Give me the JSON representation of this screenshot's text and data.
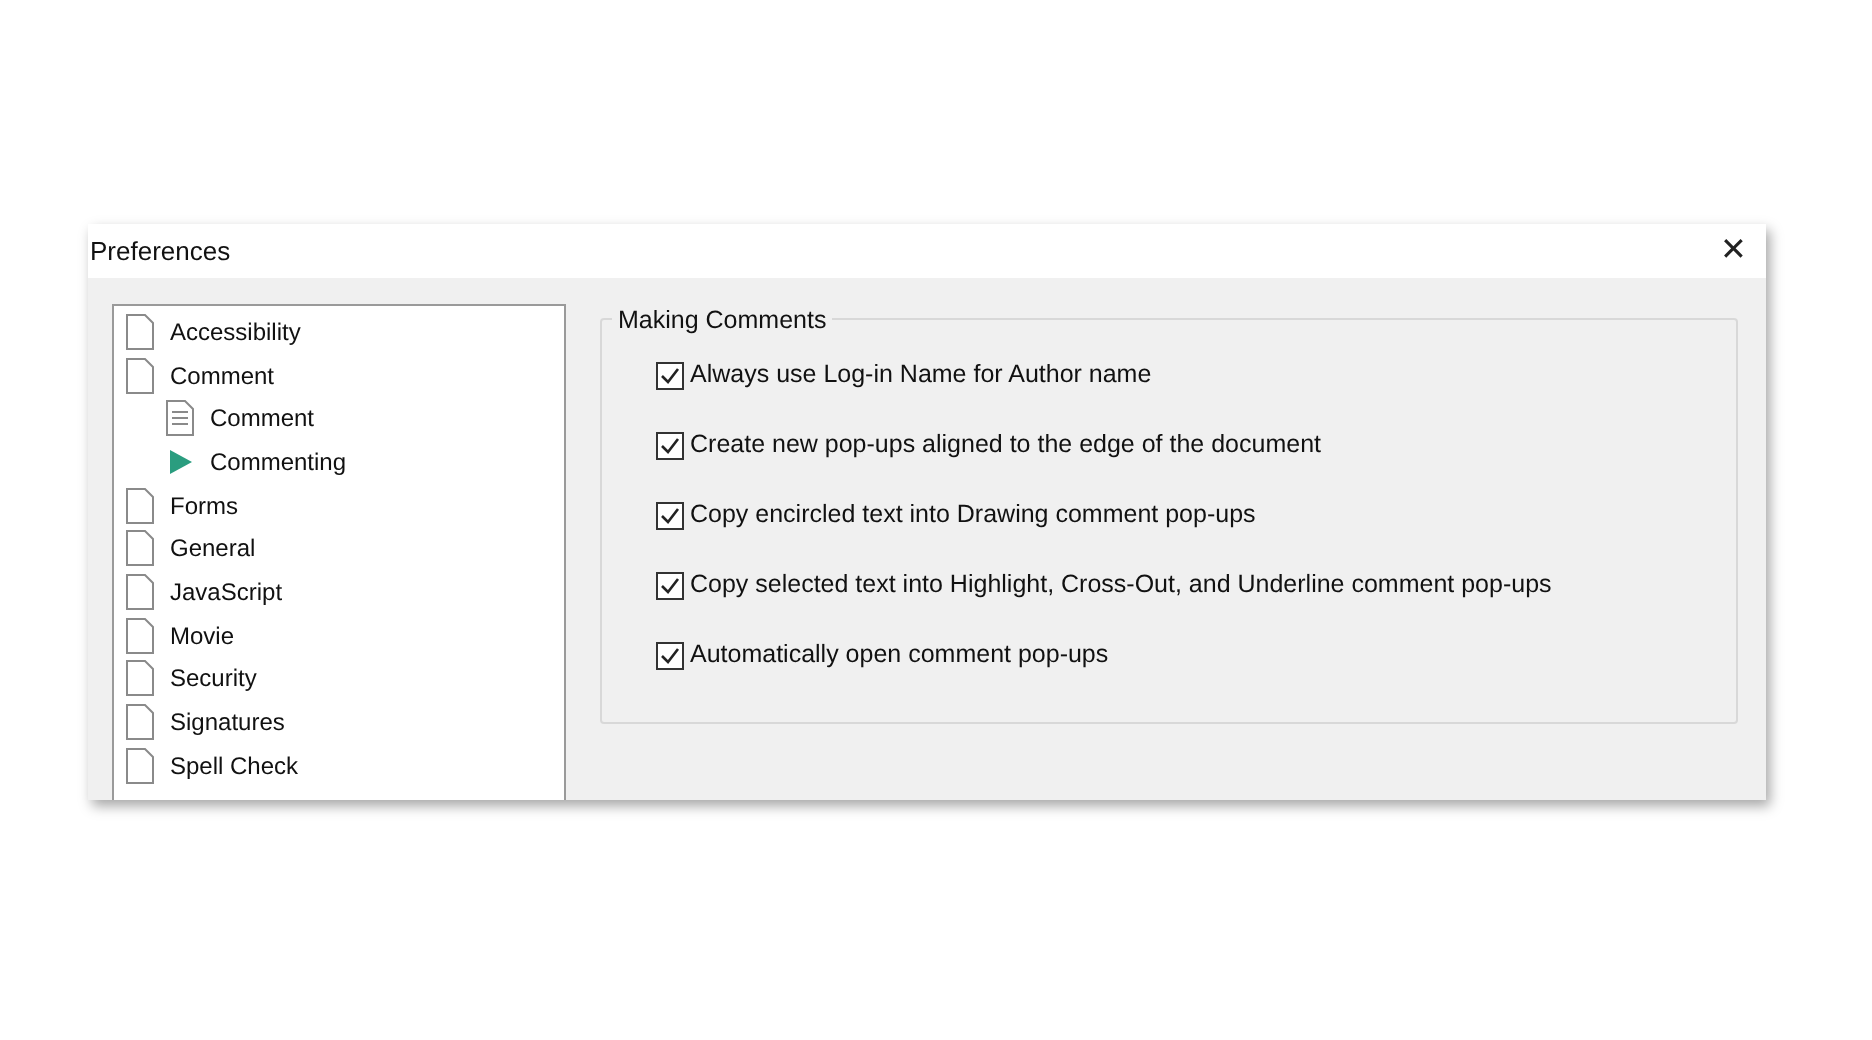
{
  "window": {
    "title": "Preferences",
    "close": "✕"
  },
  "tree": [
    {
      "label": "Accessibility",
      "selected": false
    },
    {
      "label": "Comment",
      "selected": false,
      "children": [
        {
          "label": "Comment",
          "selected": false,
          "kind": "lined-page"
        },
        {
          "label": "Commenting",
          "selected": true
        }
      ]
    },
    {
      "label": "Forms",
      "selected": false
    },
    {
      "label": "General",
      "selected": false
    },
    {
      "label": "JavaScript",
      "selected": false
    },
    {
      "label": "Movie",
      "selected": false
    },
    {
      "label": "Security",
      "selected": false
    },
    {
      "label": "Signatures",
      "selected": false
    },
    {
      "label": "Spell Check",
      "selected": false
    }
  ],
  "group": {
    "title": "Making Comments",
    "options": [
      {
        "label": "Always use Log-in Name for Author name",
        "checked": true
      },
      {
        "label": "Create new pop-ups aligned to the edge of the document",
        "checked": true
      },
      {
        "label": "Copy encircled text into Drawing comment pop-ups",
        "checked": true
      },
      {
        "label": "Copy selected text into Highlight, Cross-Out, and Underline comment pop-ups",
        "checked": true
      },
      {
        "label": "Automatically open comment pop-ups",
        "checked": true
      }
    ]
  }
}
